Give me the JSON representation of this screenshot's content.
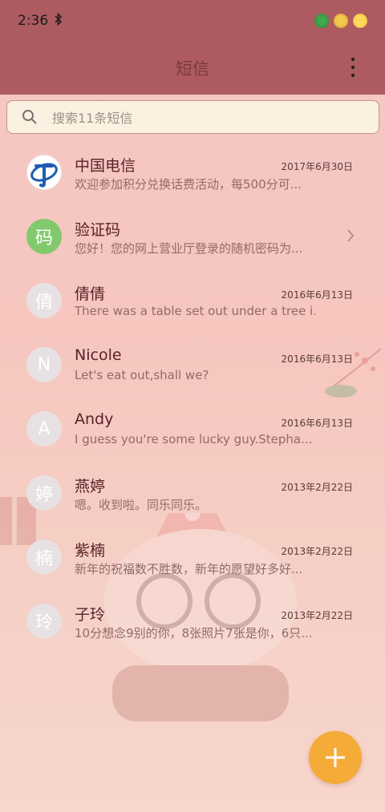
{
  "status_bar": {
    "time": "2:36",
    "bluetooth_glyph": "✱"
  },
  "header": {
    "title": "短信",
    "more_icon": "more-vert-icon"
  },
  "search": {
    "placeholder": "搜索11条短信",
    "icon": "search-icon"
  },
  "conversations": [
    {
      "name": "中国电信",
      "date": "2017年6月30日",
      "preview": "欢迎参加积分兑换话费活动，每500分可...",
      "avatar_type": "logo",
      "avatar_text": ""
    },
    {
      "name": "验证码",
      "date": "",
      "preview": "您好！您的网上营业厅登录的随机密码为...",
      "avatar_type": "green",
      "avatar_text": "码"
    },
    {
      "name": "倩倩",
      "date": "2016年6月13日",
      "preview": "There was a table set out under a tree i...",
      "avatar_type": "gray",
      "avatar_text": "倩"
    },
    {
      "name": "Nicole",
      "date": "2016年6月13日",
      "preview": "Let's eat out,shall we?",
      "avatar_type": "gray",
      "avatar_text": "N"
    },
    {
      "name": "Andy",
      "date": "2016年6月13日",
      "preview": "I guess you're some lucky guy.Stepha...",
      "avatar_type": "gray",
      "avatar_text": "A"
    },
    {
      "name": "燕婷",
      "date": "2013年2月22日",
      "preview": "嗯。收到啦。同乐同乐。",
      "avatar_type": "gray",
      "avatar_text": "婷"
    },
    {
      "name": "紫楠",
      "date": "2013年2月22日",
      "preview": "新年的祝福数不胜数，新年的愿望好多好...",
      "avatar_type": "gray",
      "avatar_text": "楠"
    },
    {
      "name": "子玲",
      "date": "2013年2月22日",
      "preview": "10分想念9别的你，8张照片7张是你，6只...",
      "avatar_type": "gray",
      "avatar_text": "玲"
    }
  ],
  "colors": {
    "header_bg": "#ad5a60",
    "fab": "#f5ab38",
    "green_avatar": "#82c96d"
  }
}
